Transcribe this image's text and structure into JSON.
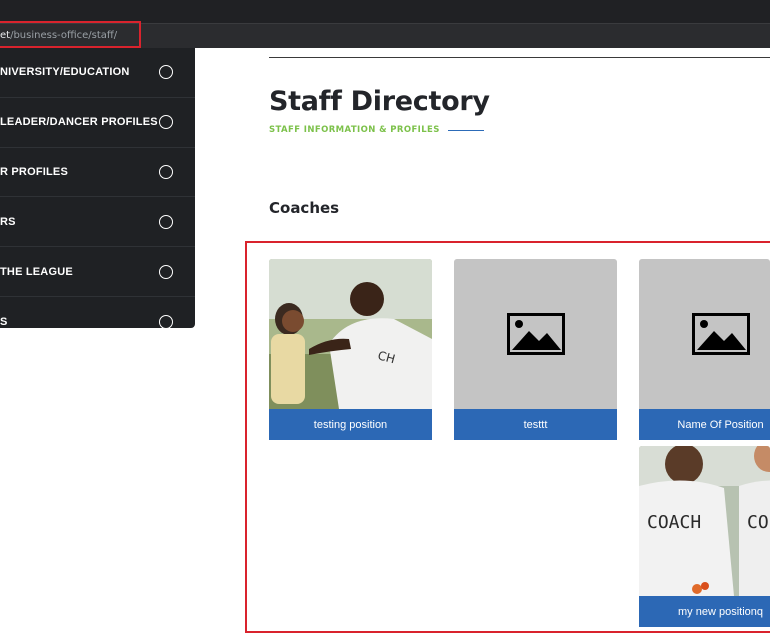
{
  "browser": {
    "url_prefix": "et",
    "url_rest": "/business-office/staff/"
  },
  "menu": {
    "items": [
      {
        "label": "NIVERSITY/EDUCATION"
      },
      {
        "label": "LEADER/DANCER PROFILES"
      },
      {
        "label": "R PROFILES"
      },
      {
        "label": "RS"
      },
      {
        "label": "THE LEAGUE"
      },
      {
        "label": "S"
      }
    ]
  },
  "page": {
    "title": "Staff Directory",
    "subtitle": "STAFF INFORMATION & PROFILES",
    "section_title": "Coaches"
  },
  "cards": [
    {
      "caption": "testing position",
      "image": "photo-coach-with-child"
    },
    {
      "caption": "testtt",
      "image": "placeholder-image-icon"
    },
    {
      "caption": "Name Of Position",
      "image": "placeholder-image-icon"
    },
    {
      "caption": "my new positionq",
      "image": "photo-coach-shirts"
    }
  ],
  "colors": {
    "accent_green": "#7cc14a",
    "caption_blue": "#2c68b5",
    "highlight_red": "#d9232d",
    "menu_bg": "#1f2124"
  }
}
